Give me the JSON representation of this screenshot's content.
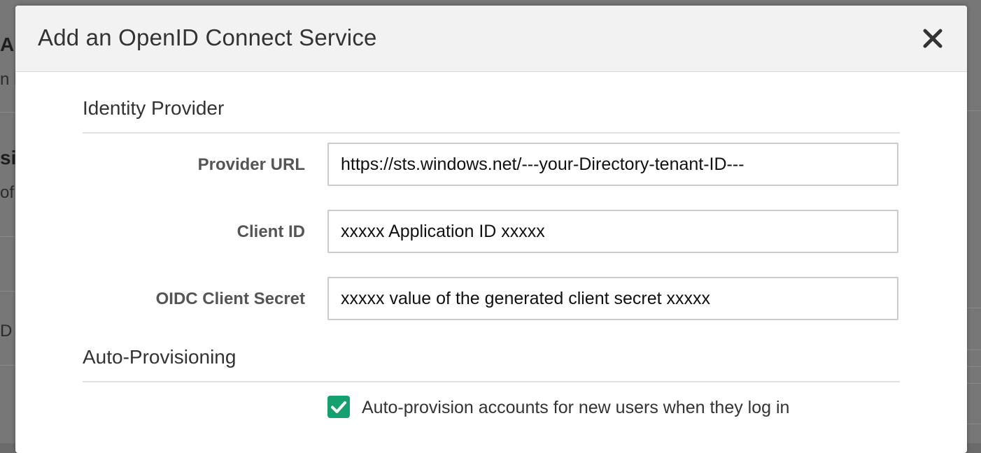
{
  "background_fragments": {
    "frag1": "Au",
    "frag2": "n le",
    "frag3": "sig",
    "frag4": "of",
    "frag5": "D S"
  },
  "modal": {
    "title": "Add an OpenID Connect Service",
    "close_icon": "close-icon"
  },
  "identity_provider": {
    "heading": "Identity Provider",
    "fields": [
      {
        "label": "Provider URL",
        "value": "https://sts.windows.net/---your-Directory-tenant-ID---"
      },
      {
        "label": "Client ID",
        "value": "xxxxx Application ID xxxxx"
      },
      {
        "label": "OIDC Client Secret",
        "value": "xxxxx value of the generated client secret xxxxx"
      }
    ]
  },
  "auto_provisioning": {
    "heading": "Auto-Provisioning",
    "checkbox_label": "Auto-provision accounts for new users when they log in",
    "checked": true
  },
  "colors": {
    "accent_checkbox": "#16a070",
    "header_bg": "#f2f2f2",
    "overlay": "#777777"
  }
}
